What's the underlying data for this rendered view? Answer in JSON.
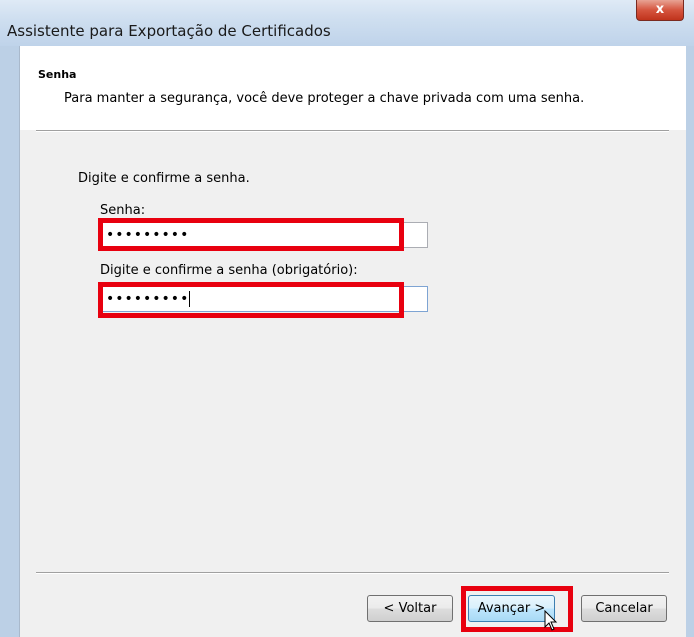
{
  "window": {
    "title": "Assistente para Exportação de Certificados",
    "close_glyph": "x"
  },
  "header": {
    "title": "Senha",
    "description": "Para manter a segurança, você deve proteger a chave privada com uma senha."
  },
  "form": {
    "instruction": "Digite e confirme a senha.",
    "password_label": "Senha:",
    "password_value": "•••••••••",
    "confirm_label": "Digite e confirme a senha (obrigatório):",
    "confirm_value": "•••••••••"
  },
  "buttons": {
    "back": "< Voltar",
    "next": "Avançar >",
    "cancel": "Cancelar"
  },
  "colors": {
    "highlight": "#e8000f",
    "titlebar": "#cfdff0",
    "dialog_bg": "#f0f0f0",
    "close_button": "#c0331c"
  },
  "icons": [
    "close-icon",
    "mouse-pointer-icon"
  ]
}
